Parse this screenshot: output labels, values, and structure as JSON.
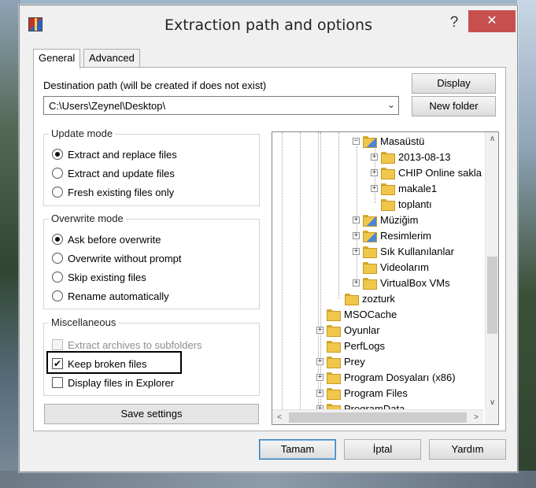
{
  "window": {
    "title": "Extraction path and options",
    "help_symbol": "?",
    "close_symbol": "✕"
  },
  "tabs": [
    {
      "label": "General",
      "active": true
    },
    {
      "label": "Advanced",
      "active": false
    }
  ],
  "destination": {
    "label": "Destination path (will be created if does not exist)",
    "value": "C:\\Users\\Zeynel\\Desktop\\",
    "dropdown_arrow": "⌄"
  },
  "buttons": {
    "display": "Display",
    "new_folder": "New folder",
    "save_settings": "Save settings",
    "ok": "Tamam",
    "cancel": "İptal",
    "help": "Yardım"
  },
  "update_mode": {
    "title": "Update mode",
    "options": [
      {
        "label": "Extract and replace files",
        "selected": true
      },
      {
        "label": "Extract and update files",
        "selected": false
      },
      {
        "label": "Fresh existing files only",
        "selected": false
      }
    ]
  },
  "overwrite_mode": {
    "title": "Overwrite mode",
    "options": [
      {
        "label": "Ask before overwrite",
        "selected": true
      },
      {
        "label": "Overwrite without prompt",
        "selected": false
      },
      {
        "label": "Skip existing files",
        "selected": false
      },
      {
        "label": "Rename automatically",
        "selected": false
      }
    ]
  },
  "misc": {
    "title": "Miscellaneous",
    "options": [
      {
        "label": "Extract archives to subfolders",
        "checked": false,
        "enabled": false
      },
      {
        "label": "Keep broken files",
        "checked": true,
        "enabled": true
      },
      {
        "label": "Display files in Explorer",
        "checked": false,
        "enabled": true
      }
    ]
  },
  "tree": {
    "items": [
      {
        "label": "Masaüstü",
        "expander": "−",
        "icon": "desktop-folder-icon"
      },
      {
        "label": "2013-08-13",
        "expander": "+",
        "icon": "folder-icon"
      },
      {
        "label": "CHIP Online sakla",
        "expander": "+",
        "icon": "folder-icon"
      },
      {
        "label": "makale1",
        "expander": "+",
        "icon": "folder-icon"
      },
      {
        "label": "toplantı",
        "expander": "",
        "icon": "folder-icon"
      },
      {
        "label": "Müziğim",
        "expander": "+",
        "icon": "music-folder-icon"
      },
      {
        "label": "Resimlerim",
        "expander": "+",
        "icon": "pictures-folder-icon"
      },
      {
        "label": "Sık Kullanılanlar",
        "expander": "+",
        "icon": "favorites-folder-icon"
      },
      {
        "label": "Videolarım",
        "expander": "",
        "icon": "videos-folder-icon"
      },
      {
        "label": "VirtualBox VMs",
        "expander": "+",
        "icon": "folder-icon"
      },
      {
        "label": "zozturk",
        "expander": "",
        "icon": "folder-icon"
      },
      {
        "label": "MSOCache",
        "expander": "",
        "icon": "folder-icon"
      },
      {
        "label": "Oyunlar",
        "expander": "+",
        "icon": "folder-icon"
      },
      {
        "label": "PerfLogs",
        "expander": "",
        "icon": "folder-icon"
      },
      {
        "label": "Prey",
        "expander": "+",
        "icon": "folder-icon"
      },
      {
        "label": "Program Dosyaları (x86)",
        "expander": "+",
        "icon": "folder-icon"
      },
      {
        "label": "Program Files",
        "expander": "+",
        "icon": "folder-icon"
      },
      {
        "label": "ProgramData",
        "expander": "+",
        "icon": "folder-icon"
      }
    ],
    "scroll_up": "∧",
    "scroll_down": "∨",
    "scroll_left": "<",
    "scroll_right": ">"
  }
}
